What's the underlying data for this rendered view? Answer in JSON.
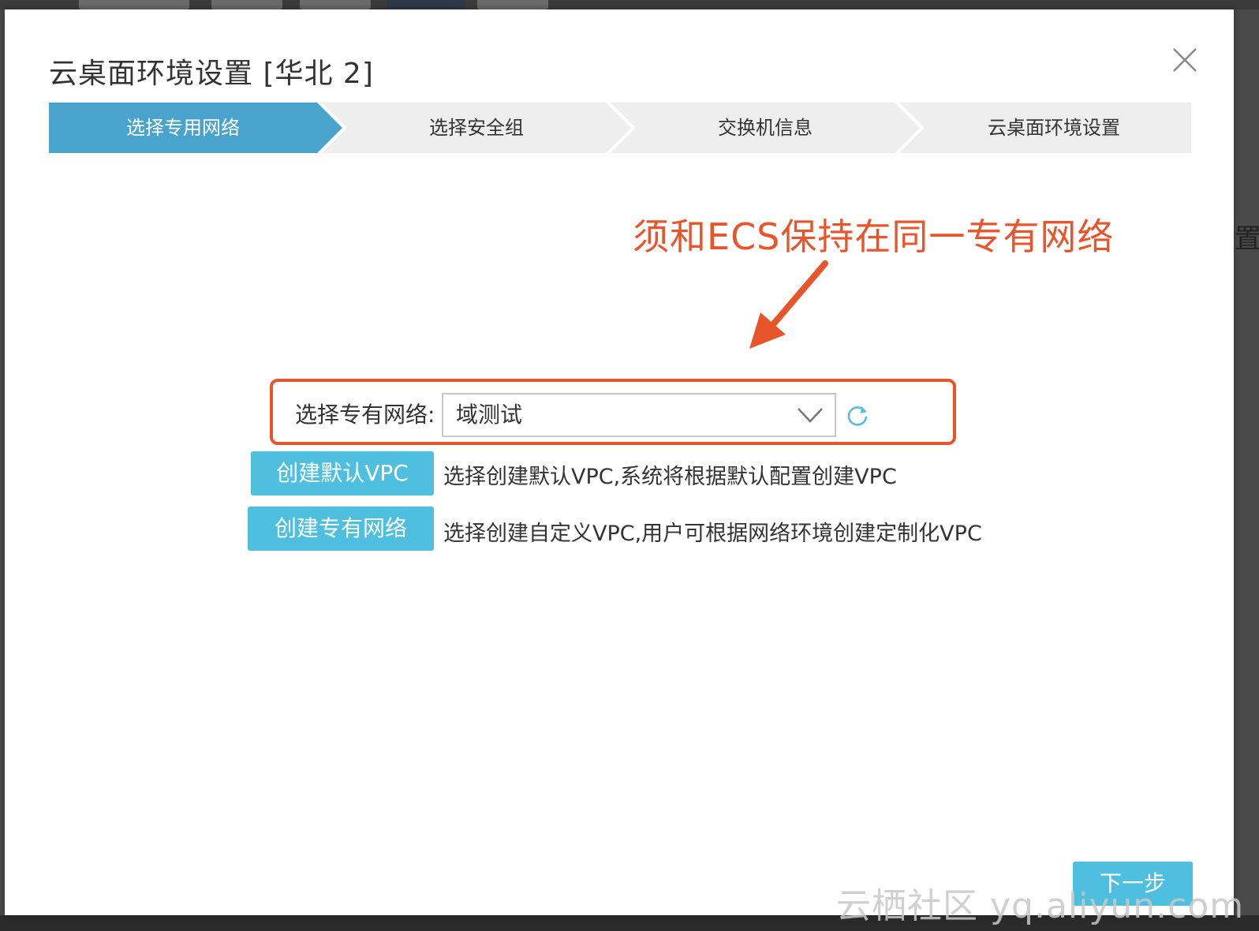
{
  "modal": {
    "title": "云桌面环境设置 [华北 2]"
  },
  "steps": [
    {
      "label": "选择专用网络",
      "active": true
    },
    {
      "label": "选择安全组",
      "active": false
    },
    {
      "label": "交换机信息",
      "active": false
    },
    {
      "label": "云桌面环境设置",
      "active": false
    }
  ],
  "annotation": {
    "text": "须和ECS保持在同一专有网络"
  },
  "vpc": {
    "label": "选择专有网络:",
    "selected_value": "域测试"
  },
  "actions": {
    "create_default_vpc_label": "创建默认VPC",
    "create_default_vpc_desc": "选择创建默认VPC,系统将根据默认配置创建VPC",
    "create_custom_vpc_label": "创建专有网络",
    "create_custom_vpc_desc": "选择创建自定义VPC,用户可根据网络环境创建定制化VPC",
    "next_label": "下一步"
  },
  "background": {
    "right_text": "置"
  },
  "watermark": {
    "text": "云栖社区 yq.aliyun.com"
  },
  "colors": {
    "primary": "#4fbfe0",
    "step_active": "#4aa3cc",
    "step_inactive": "#eeeeee",
    "annotation": "#e8552b",
    "text": "#333333"
  }
}
